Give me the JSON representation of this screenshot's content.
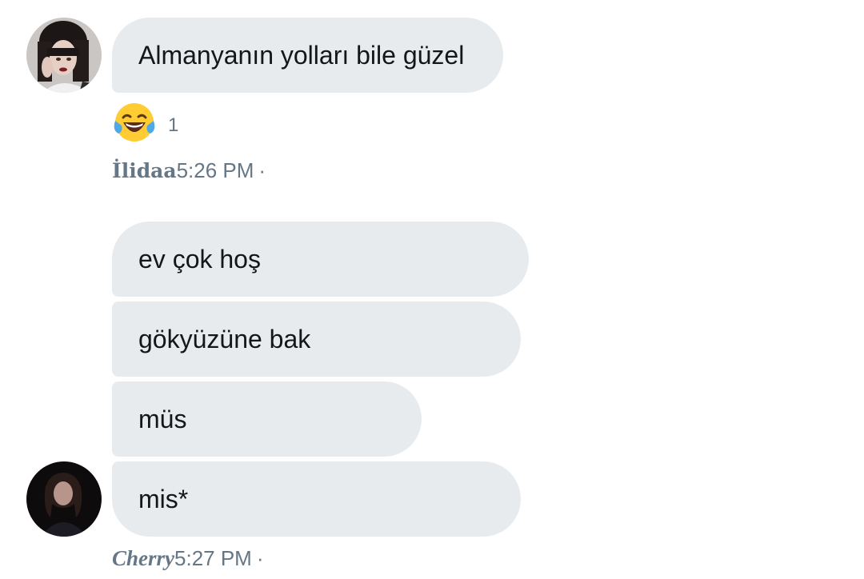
{
  "conversation": {
    "group1": {
      "sender": "İlidaa",
      "time": "5:26 PM",
      "separator": "·",
      "messages": [
        "Almanyanın yolları bile güzel"
      ],
      "reaction": {
        "emoji": "😂",
        "count": "1"
      }
    },
    "group2": {
      "sender": "Cherry",
      "time": "5:27 PM",
      "separator": "·",
      "messages": [
        "ev çok hoş",
        "gökyüzüne bak",
        "müs",
        "mis*"
      ]
    }
  },
  "colors": {
    "bubble": "#e8ebee",
    "text": "#14171a",
    "meta": "#657786"
  }
}
